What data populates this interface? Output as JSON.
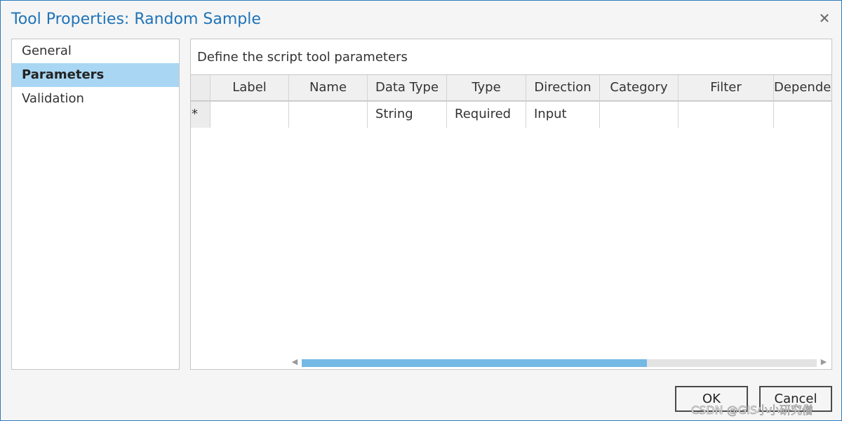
{
  "window": {
    "title": "Tool Properties: Random Sample",
    "close_icon": "close-icon"
  },
  "nav": {
    "items": [
      {
        "label": "General",
        "active": false
      },
      {
        "label": "Parameters",
        "active": true
      },
      {
        "label": "Validation",
        "active": false
      }
    ]
  },
  "panel": {
    "description": "Define the script tool parameters"
  },
  "grid": {
    "columns": [
      "Label",
      "Name",
      "Data Type",
      "Type",
      "Direction",
      "Category",
      "Filter",
      "Dependency"
    ],
    "new_row_marker": "*",
    "new_row": [
      "",
      "",
      "String",
      "Required",
      "Input",
      "",
      "",
      ""
    ]
  },
  "scrollbar": {
    "left_arrow_icon": "scroll-left-icon",
    "right_arrow_icon": "scroll-right-icon",
    "thumb_fraction": 0.67
  },
  "buttons": {
    "ok": "OK",
    "cancel": "Cancel"
  },
  "watermark": "CSDN @GIS小小研究僧",
  "colors": {
    "accent": "#1f73b7",
    "selection": "#a9d7f3",
    "scroll_thumb": "#74b9e4"
  }
}
